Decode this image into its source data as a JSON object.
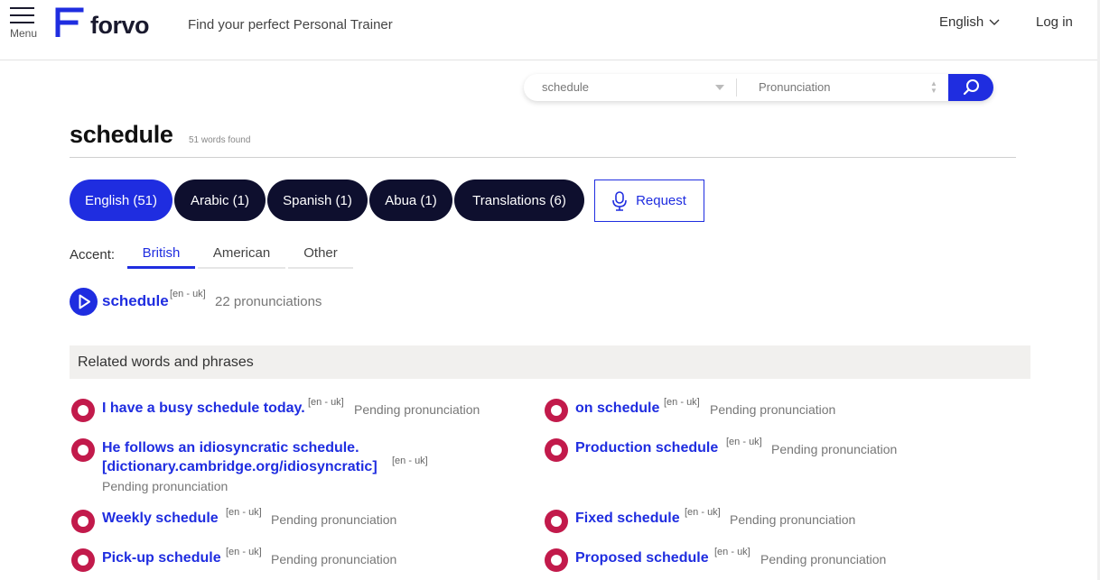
{
  "header": {
    "menu_label": "Menu",
    "logo_text": "forvo",
    "tagline": "Find your perfect Personal Trainer",
    "language": "English",
    "login": "Log in"
  },
  "search": {
    "value": "schedule",
    "mode": "Pronunciation"
  },
  "page": {
    "title": "schedule",
    "count": "51 words found"
  },
  "lang_tabs": [
    {
      "label": "English (51)"
    },
    {
      "label": "Arabic (1)"
    },
    {
      "label": "Spanish (1)"
    },
    {
      "label": "Abua (1)"
    },
    {
      "label": "Translations (6)"
    }
  ],
  "request_label": "Request",
  "accent": {
    "label": "Accent:",
    "tabs": [
      {
        "label": "British"
      },
      {
        "label": "American"
      },
      {
        "label": "Other"
      }
    ]
  },
  "main_word": {
    "word": "schedule",
    "tag": "[en - uk]",
    "count": "22 pronunciations"
  },
  "related": {
    "title": "Related words and phrases",
    "items": [
      {
        "line1": "I have a busy schedule today.",
        "tag": "[en - uk]",
        "status": "Pending pronunciation"
      },
      {
        "line1": "on schedule",
        "tag": "[en - uk]",
        "status": "Pending pronunciation"
      },
      {
        "line1": "He follows an idiosyncratic schedule.",
        "line2": "[dictionary.cambridge.org/idiosyncratic]",
        "tag": "[en - uk]",
        "status": "Pending pronunciation"
      },
      {
        "line1": "Production schedule",
        "tag": "[en - uk]",
        "status": "Pending pronunciation"
      },
      {
        "line1": "Weekly schedule",
        "tag": "[en - uk]",
        "status": "Pending pronunciation"
      },
      {
        "line1": "Fixed schedule",
        "tag": "[en - uk]",
        "status": "Pending pronunciation"
      },
      {
        "line1": "Pick-up schedule",
        "tag": "[en - uk]",
        "status": "Pending pronunciation"
      },
      {
        "line1": "Proposed schedule",
        "tag": "[en - uk]",
        "status": "Pending pronunciation"
      }
    ]
  },
  "colors": {
    "brand_blue": "#1f2de0",
    "dark_tab": "#0e0f2e",
    "record_red": "#c21a4b"
  }
}
